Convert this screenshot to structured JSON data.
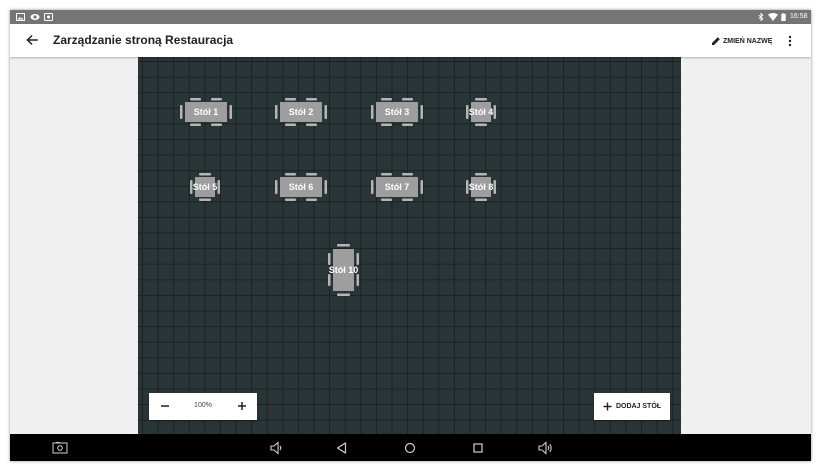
{
  "status_bar": {
    "time": "16:58",
    "left_icons": [
      "image-icon",
      "eye-icon",
      "app-icon"
    ],
    "right_icons": [
      "bluetooth-icon",
      "wifi-icon",
      "battery-icon"
    ]
  },
  "app_bar": {
    "back_icon": "arrow-back-icon",
    "title": "Zarządzanie stroną Restauracja",
    "rename_label": "ZMIEŃ NAZWĘ",
    "rename_icon": "pencil-icon",
    "more_icon": "more-vert-icon"
  },
  "floor": {
    "grid_color": "#1a2224",
    "background_color": "#2a3537",
    "tables": [
      {
        "label": "Stół 1",
        "shape": "rect-6"
      },
      {
        "label": "Stół 2",
        "shape": "rect-6"
      },
      {
        "label": "Stół 3",
        "shape": "rect-6"
      },
      {
        "label": "Stół 4",
        "shape": "square-4"
      },
      {
        "label": "Stół 5",
        "shape": "square-4"
      },
      {
        "label": "Stół 6",
        "shape": "rect-6"
      },
      {
        "label": "Stół 7",
        "shape": "rect-6"
      },
      {
        "label": "Stół 8",
        "shape": "square-4"
      },
      {
        "label": "Stół 10",
        "shape": "vertical-6"
      }
    ]
  },
  "zoom": {
    "minus_icon": "minus-icon",
    "level": "100%",
    "plus_icon": "plus-icon"
  },
  "add_table": {
    "label": "DODAJ STÓŁ",
    "icon": "plus-icon"
  },
  "nav_bar": {
    "icons": [
      "screenshot-icon",
      "volume-down-icon",
      "back-triangle-icon",
      "home-circle-icon",
      "recents-square-icon",
      "volume-up-icon"
    ]
  },
  "colors": {
    "table_fill": "#9e9e9e",
    "chair_fill": "#b5b5b5",
    "nav_bg": "#000000",
    "status_bg": "#757575"
  }
}
